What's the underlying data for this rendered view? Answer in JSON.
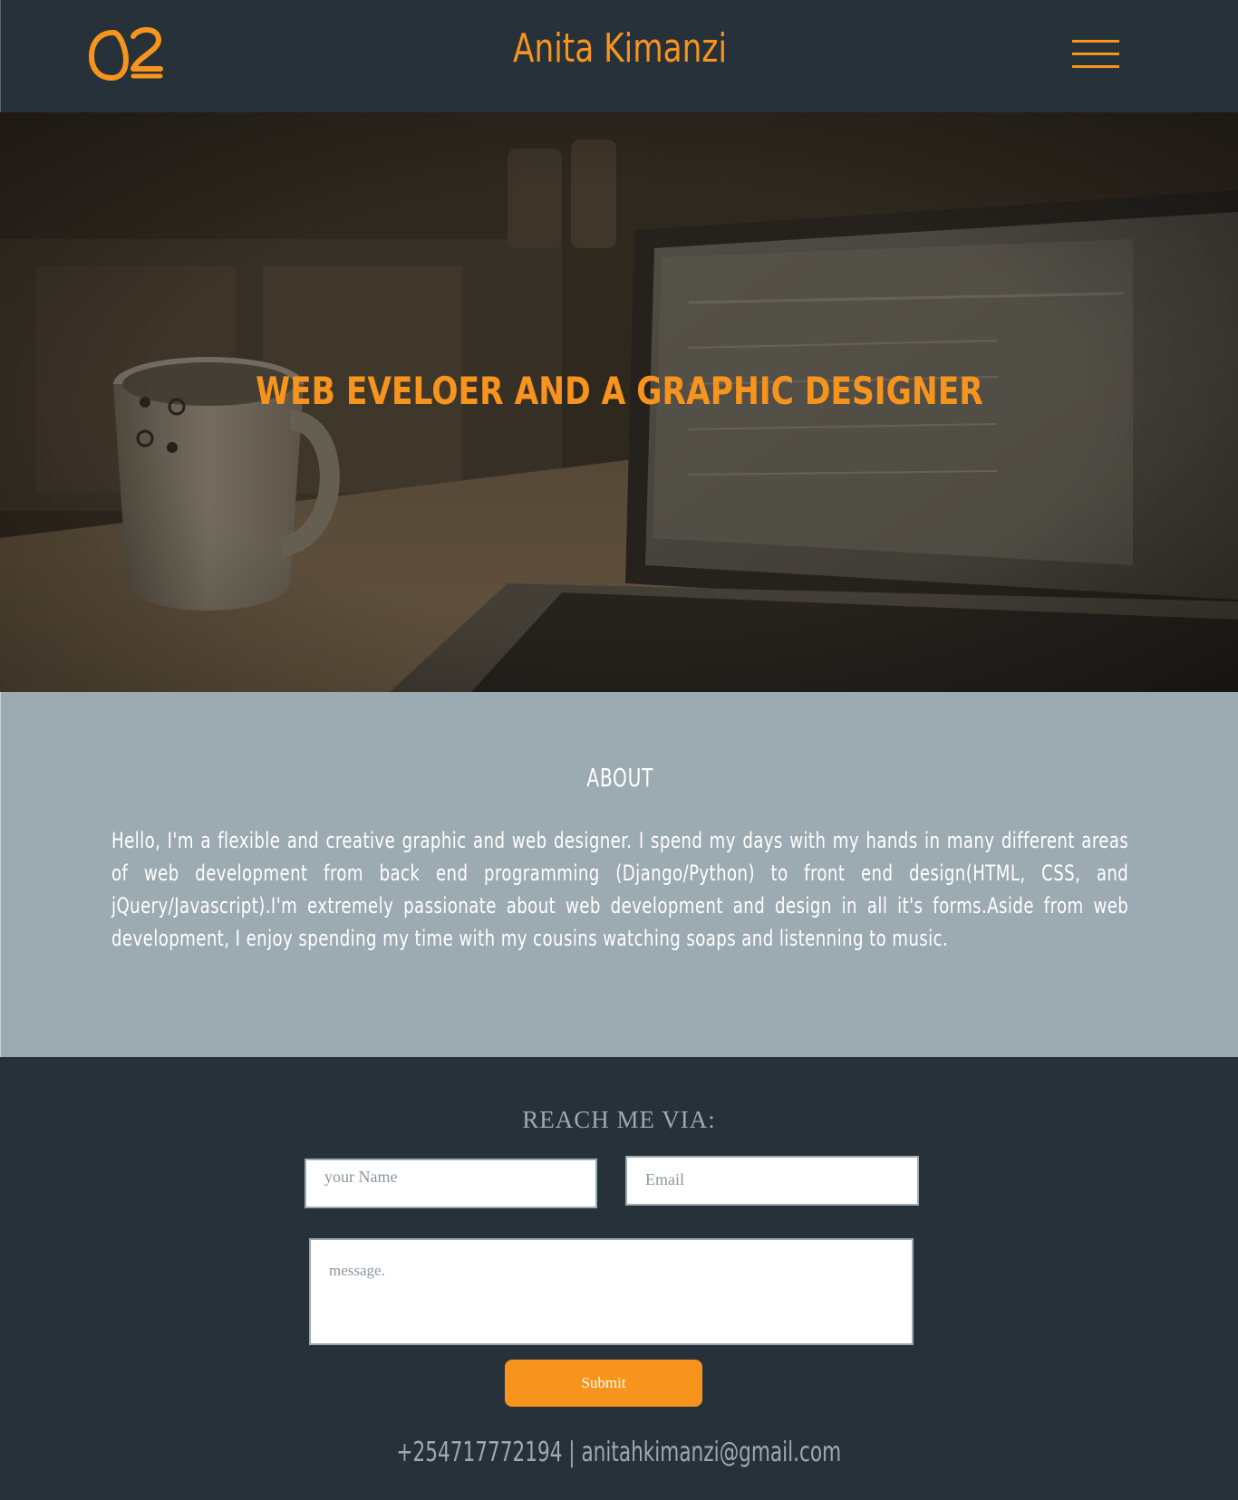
{
  "header": {
    "title": "Anita Kimanzi",
    "logo_icon": "ak-monogram-logo",
    "menu_icon": "hamburger-menu-icon"
  },
  "hero": {
    "heading": "WEB EVELOER AND A GRAPHIC DESIGNER"
  },
  "about": {
    "title": "ABOUT",
    "text": "Hello, I'm a flexible and creative graphic and web designer. I spend my days with my hands in many different areas of web development from back end programming (Django/Python) to front end design(HTML, CSS, and jQuery/Javascript).I'm extremely passionate about web development and design in all it's forms.Aside from web development, I enjoy spending my time with my cousins watching soaps and listenning to music."
  },
  "contact": {
    "title": "REACH ME VIA:",
    "name_placeholder": "your Name",
    "email_placeholder": "Email",
    "message_placeholder": "message.",
    "submit_label": "Submit",
    "footer_info": "+254717772194 | anitahkimanzi@gmail.com"
  },
  "colors": {
    "accent": "#f7941d",
    "dark": "#273139",
    "about_bg": "#9caab2"
  }
}
